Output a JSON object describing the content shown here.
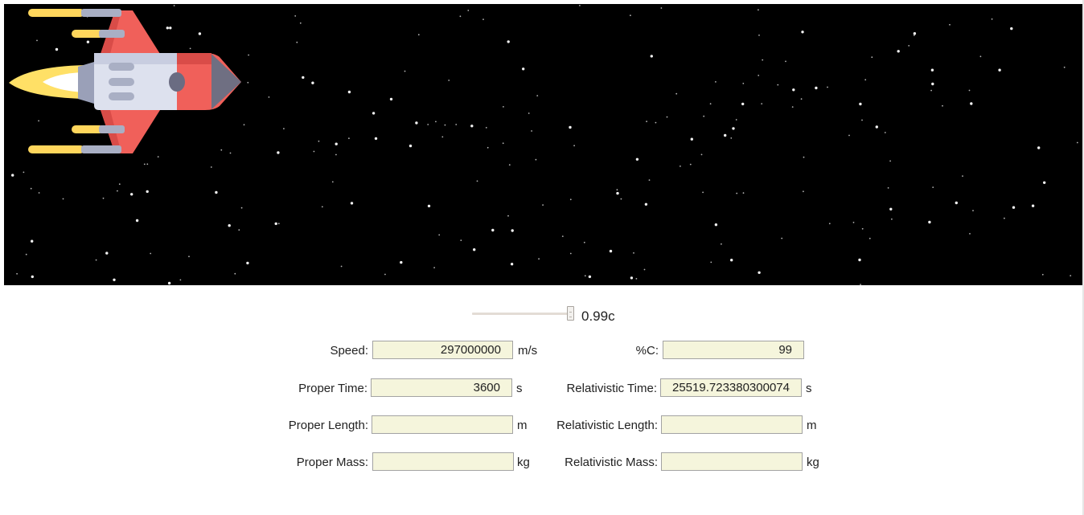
{
  "slider": {
    "value_label": "0.99c",
    "fraction": 0.99
  },
  "fields": {
    "speed": {
      "label": "Speed:",
      "value": "297000000",
      "unit": "m/s"
    },
    "percent_c": {
      "label": "%C:",
      "value": "99"
    },
    "proper_time": {
      "label": "Proper Time:",
      "value": "3600",
      "unit": "s"
    },
    "relativistic_time": {
      "label": "Relativistic Time:",
      "value": "25519.723380300074",
      "unit": "s"
    },
    "proper_length": {
      "label": "Proper Length:",
      "value": "",
      "unit": "m"
    },
    "relativistic_length": {
      "label": "Relativistic Length:",
      "value": "",
      "unit": "m"
    },
    "proper_mass": {
      "label": "Proper Mass:",
      "value": "",
      "unit": "kg"
    },
    "relativistic_mass": {
      "label": "Relativistic Mass:",
      "value": "",
      "unit": "kg"
    }
  },
  "icons": {
    "ship": "rocket-ship-icon",
    "background": "starfield"
  },
  "colors": {
    "space": "#000000",
    "field_bg": "#f5f5dc",
    "hull": "#dde1ee",
    "fin": "#f0605a",
    "flame": "#ffe066"
  }
}
